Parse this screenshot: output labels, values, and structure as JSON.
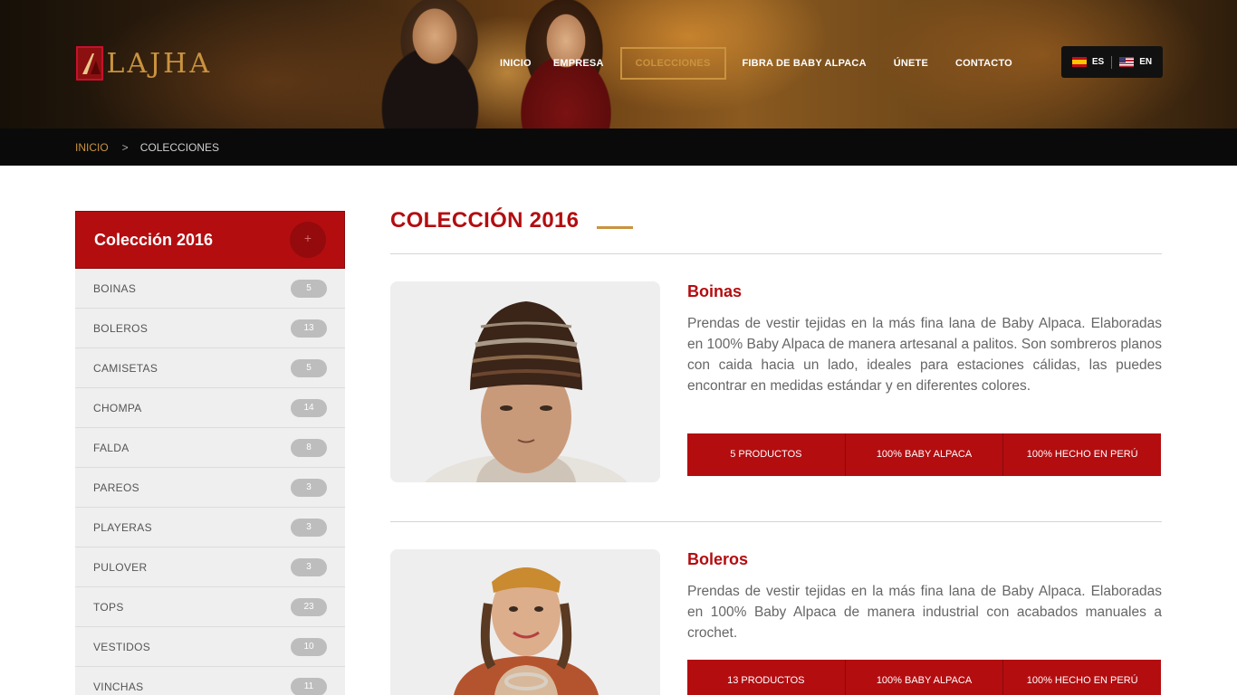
{
  "brand": {
    "logo_text": "LAJHA"
  },
  "nav": {
    "items": [
      {
        "label": "INICIO"
      },
      {
        "label": "EMPRESA"
      },
      {
        "label": "COLECCIONES"
      },
      {
        "label": "FIBRA DE BABY ALPACA"
      },
      {
        "label": "ÚNETE"
      },
      {
        "label": "CONTACTO"
      }
    ],
    "active": "COLECCIONES"
  },
  "lang": {
    "es": "ES",
    "en": "EN"
  },
  "breadcrumb": {
    "home": "INICIO",
    "separator": ">",
    "current": "COLECCIONES"
  },
  "sidebar": {
    "title": "Colección 2016",
    "toggle": "+",
    "items": [
      {
        "label": "BOINAS",
        "count": "5"
      },
      {
        "label": "BOLEROS",
        "count": "13"
      },
      {
        "label": "CAMISETAS",
        "count": "5"
      },
      {
        "label": "CHOMPA",
        "count": "14"
      },
      {
        "label": "FALDA",
        "count": "8"
      },
      {
        "label": "PAREOS",
        "count": "3"
      },
      {
        "label": "PLAYERAS",
        "count": "3"
      },
      {
        "label": "PULOVER",
        "count": "3"
      },
      {
        "label": "TOPS",
        "count": "23"
      },
      {
        "label": "VESTIDOS",
        "count": "10"
      },
      {
        "label": "VINCHAS",
        "count": "11"
      }
    ]
  },
  "main": {
    "title": "COLECCIÓN 2016",
    "products": [
      {
        "name": "Boinas",
        "description": "Prendas de vestir tejidas en la más fina lana de Baby Alpaca. Elaboradas en 100% Baby Alpaca de manera artesanal a palitos. Son sombreros planos con caida hacia un lado, ideales para estaciones cálidas, las puedes encontrar en medidas estándar y en diferentes colores.",
        "badges": [
          "5 PRODUCTOS",
          "100% BABY ALPACA",
          "100% HECHO EN PERÚ"
        ]
      },
      {
        "name": "Boleros",
        "description": "Prendas de vestir tejidas en la más fina lana de Baby Alpaca. Elaboradas en 100% Baby Alpaca de manera industrial con acabados manuales a crochet.",
        "badges": [
          "13 PRODUCTOS",
          "100% BABY ALPACA",
          "100% HECHO EN PERÚ"
        ]
      }
    ]
  },
  "colors": {
    "brand_red": "#b30d10",
    "gold": "#c9933f",
    "dark_bar": "#0a0a0a"
  }
}
